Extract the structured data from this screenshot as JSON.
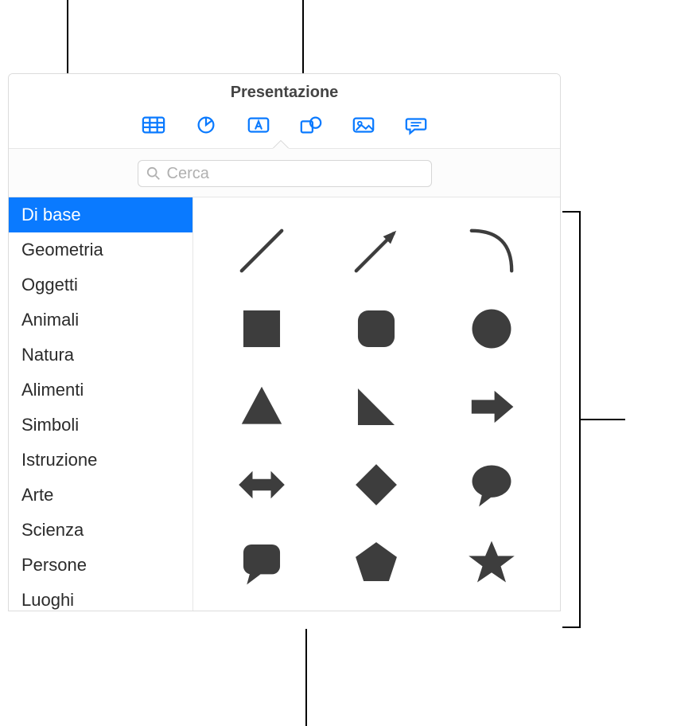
{
  "window": {
    "title": "Presentazione"
  },
  "toolbar": {
    "items": [
      {
        "name": "table-icon"
      },
      {
        "name": "chart-icon"
      },
      {
        "name": "text-icon"
      },
      {
        "name": "shape-icon"
      },
      {
        "name": "media-icon"
      },
      {
        "name": "comment-icon"
      }
    ]
  },
  "search": {
    "placeholder": "Cerca"
  },
  "sidebar": {
    "items": [
      {
        "label": "Di base",
        "selected": true
      },
      {
        "label": "Geometria",
        "selected": false
      },
      {
        "label": "Oggetti",
        "selected": false
      },
      {
        "label": "Animali",
        "selected": false
      },
      {
        "label": "Natura",
        "selected": false
      },
      {
        "label": "Alimenti",
        "selected": false
      },
      {
        "label": "Simboli",
        "selected": false
      },
      {
        "label": "Istruzione",
        "selected": false
      },
      {
        "label": "Arte",
        "selected": false
      },
      {
        "label": "Scienza",
        "selected": false
      },
      {
        "label": "Persone",
        "selected": false
      },
      {
        "label": "Luoghi",
        "selected": false
      }
    ]
  },
  "shapes": {
    "items": [
      "line",
      "arrow-line",
      "curve",
      "square",
      "rounded-square",
      "circle",
      "triangle",
      "right-triangle",
      "arrow-right",
      "arrow-leftright",
      "diamond",
      "speech-bubble",
      "chat-square",
      "pentagon",
      "star"
    ]
  },
  "colors": {
    "accent": "#0a7aff",
    "shape_fill": "#3d3d3d"
  }
}
